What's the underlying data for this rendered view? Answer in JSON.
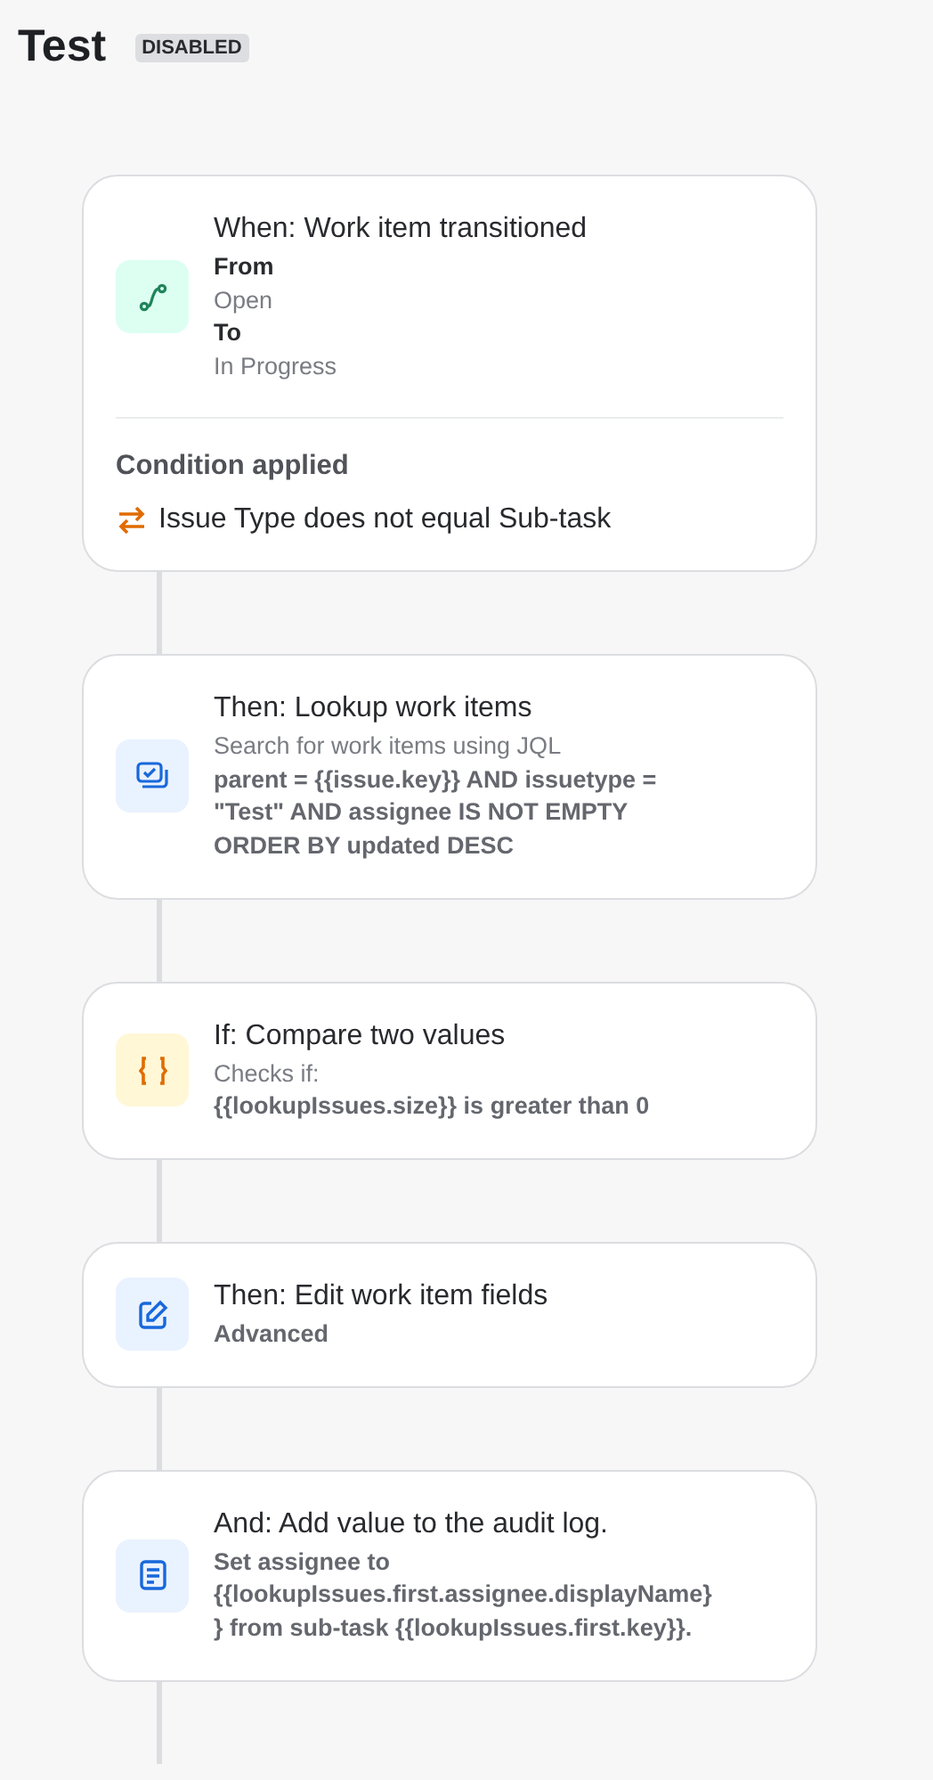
{
  "header": {
    "title": "Test",
    "badge": "DISABLED"
  },
  "steps": [
    {
      "kind": "transition",
      "title": "When: Work item transitioned",
      "lines": [
        {
          "kind": "label",
          "text": "From"
        },
        {
          "kind": "description",
          "text": "Open"
        },
        {
          "kind": "label",
          "text": "To"
        },
        {
          "kind": "description",
          "text": "In Progress"
        }
      ],
      "condition": {
        "heading": "Condition applied",
        "text": "Issue Type does not equal Sub-task"
      }
    },
    {
      "kind": "lookup",
      "title": "Then: Lookup work items",
      "lines": [
        {
          "kind": "description",
          "text": "Search for work items using JQL"
        },
        {
          "kind": "detail",
          "text": "parent = {{issue.key}} AND issuetype = \"Test\" AND assignee IS NOT EMPTY ORDER BY updated DESC"
        }
      ]
    },
    {
      "kind": "compare",
      "title": "If: Compare two values",
      "lines": [
        {
          "kind": "description",
          "text": "Checks if:"
        },
        {
          "kind": "detail",
          "text": "{{lookupIssues.size}} is greater than 0"
        }
      ]
    },
    {
      "kind": "edit",
      "title": "Then: Edit work item fields",
      "lines": [
        {
          "kind": "detail",
          "text": "Advanced"
        }
      ]
    },
    {
      "kind": "log",
      "title": "And: Add value to the audit log.",
      "lines": [
        {
          "kind": "detail",
          "text": "Set assignee to {{lookupIssues.first.assignee.displayName}} from sub-task {{lookupIssues.first.key}}."
        }
      ]
    }
  ]
}
